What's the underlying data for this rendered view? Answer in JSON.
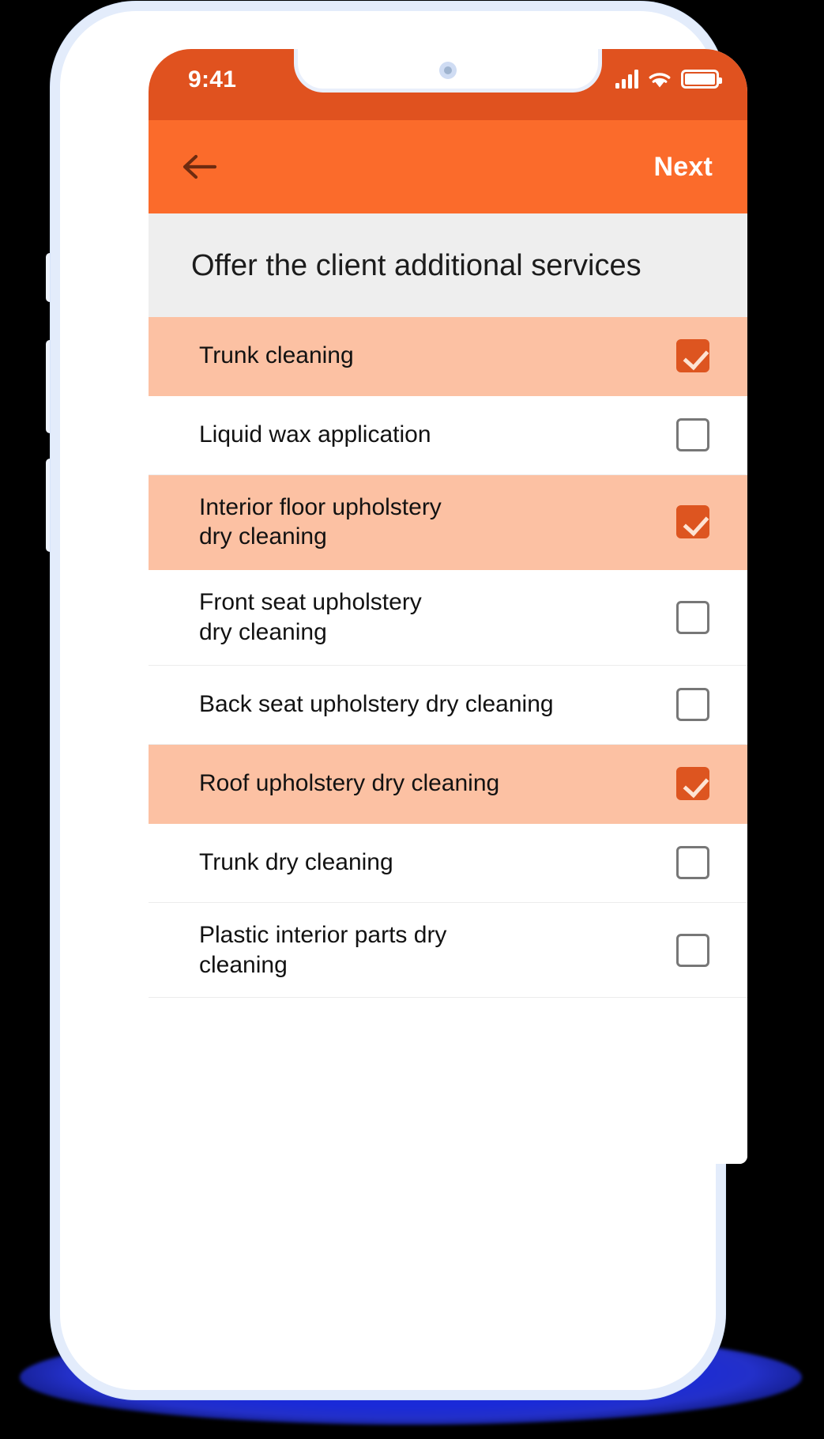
{
  "status_bar": {
    "time": "9:41",
    "icons": [
      "signal-icon",
      "wifi-icon",
      "battery-icon"
    ],
    "background_color": "#E0521F"
  },
  "nav_bar": {
    "back_icon": "back-arrow-icon",
    "next_label": "Next",
    "background_color": "#FB6B2B"
  },
  "header": {
    "title": "Offer the client\nadditional services",
    "background_color": "#EEEEEE"
  },
  "theme": {
    "accent": "#DD5520",
    "selected_row": "#FCC1A3",
    "row_background": "#FFFFFF",
    "divider": "#ECECEC",
    "page_background": "#000000",
    "shadow": "#1A2AD8"
  },
  "services": [
    {
      "label": "Trunk cleaning",
      "checked": true,
      "lines": 1
    },
    {
      "label": "Liquid wax application",
      "checked": false,
      "lines": 1
    },
    {
      "label": "Interior floor upholstery\ndry cleaning",
      "checked": true,
      "lines": 2
    },
    {
      "label": "Front seat upholstery\ndry cleaning",
      "checked": false,
      "lines": 2
    },
    {
      "label": "Back seat upholstery dry cleaning",
      "checked": false,
      "lines": 1
    },
    {
      "label": "Roof upholstery dry cleaning",
      "checked": true,
      "lines": 1
    },
    {
      "label": "Trunk dry cleaning",
      "checked": false,
      "lines": 1
    },
    {
      "label": "Plastic interior parts dry\ncleaning",
      "checked": false,
      "lines": 2
    }
  ]
}
